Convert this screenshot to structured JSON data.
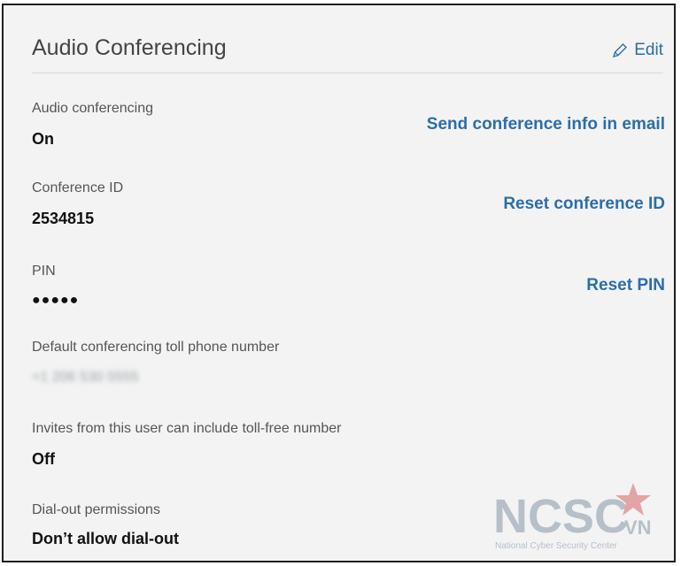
{
  "panel": {
    "title": "Audio Conferencing",
    "edit_label": "Edit"
  },
  "fields": {
    "audio_conferencing": {
      "label": "Audio conferencing",
      "value": "On",
      "action": "Send conference info in email"
    },
    "conference_id": {
      "label": "Conference ID",
      "value": "2534815",
      "action": "Reset conference ID"
    },
    "pin": {
      "label": "PIN",
      "value": "●●●●●",
      "action": "Reset PIN"
    },
    "toll_number": {
      "label": "Default conferencing toll phone number",
      "value": "+1 206 530 5555"
    },
    "toll_free": {
      "label": "Invites from this user can include toll-free number",
      "value": "Off"
    },
    "dial_out": {
      "label": "Dial-out permissions",
      "value": "Don’t allow dial-out"
    }
  },
  "watermark": {
    "logo_text": "NCSC",
    "logo_sub": "VN",
    "tagline": "National Cyber Security Center",
    "colors": {
      "main": "#b7bfc8",
      "star": "#e5a3a3"
    }
  },
  "colors": {
    "link": "#2b6ea8",
    "background": "#f3f3f3",
    "border": "#1f1f1f"
  },
  "icons": {
    "edit": "pencil-icon"
  }
}
